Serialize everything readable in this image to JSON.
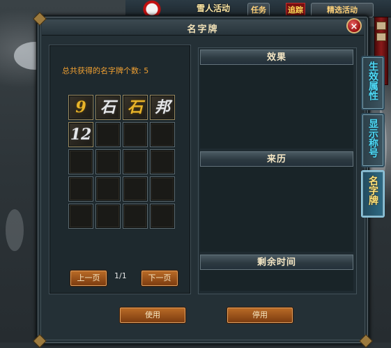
{
  "hud": {
    "event_label": "雪人活动",
    "quest_button": "任务",
    "track_label": "追踪",
    "activity_button": "精选活动"
  },
  "window": {
    "title": "名字牌",
    "close_glyph": "×"
  },
  "name_plates": {
    "total_label": "总共获得的名字牌个数: 5",
    "slots_total": 20,
    "items": [
      {
        "glyph": "9",
        "tint": "gold"
      },
      {
        "glyph": "石",
        "tint": "silver"
      },
      {
        "glyph": "石",
        "tint": "gold"
      },
      {
        "glyph": "邦",
        "tint": "silver"
      },
      {
        "glyph": "12",
        "tint": "silver"
      }
    ]
  },
  "pager": {
    "prev_label": "上一页",
    "page_text": "1/1",
    "next_label": "下一页"
  },
  "sections": {
    "effect": "效果",
    "source": "来历",
    "remaining": "剩余时间"
  },
  "actions": {
    "use_label": "使用",
    "disable_label": "停用"
  },
  "tabs": [
    {
      "label": "生效属性",
      "active": false
    },
    {
      "label": "显示称号",
      "active": false
    },
    {
      "label": "名字牌",
      "active": true
    }
  ],
  "colors": {
    "accent_orange": "#f0a032",
    "button_brown": "#9a5018",
    "tab_cyan": "#4fd8f4",
    "tab_active_gold": "#ffe27a"
  }
}
